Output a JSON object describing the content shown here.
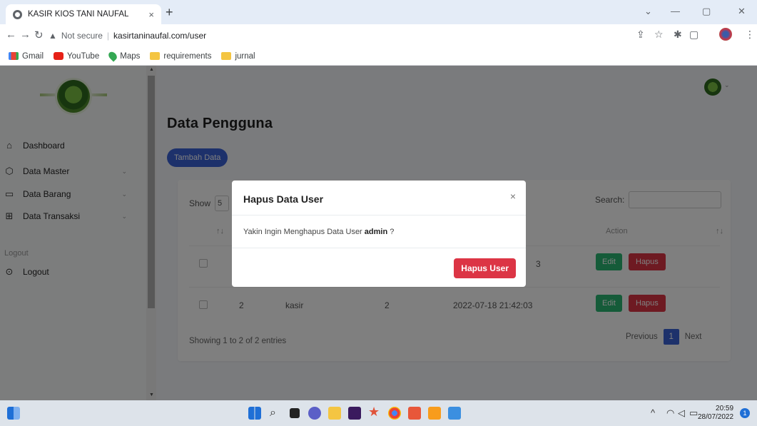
{
  "browser": {
    "tab_title": "KASIR KIOS TANI NAUFAL",
    "tab_close": "×",
    "new_tab": "+",
    "security": "Not secure",
    "url": "kasirtaninaufal.com/user",
    "bookmarks": [
      "Gmail",
      "YouTube",
      "Maps",
      "requirements",
      "jurnal"
    ]
  },
  "sidebar": {
    "items": [
      {
        "label": "Dashboard"
      },
      {
        "label": "Data Master"
      },
      {
        "label": "Data Barang"
      },
      {
        "label": "Data Transaksi"
      }
    ],
    "section": "Logout",
    "logout": "Logout"
  },
  "main": {
    "title": "Data Pengguna",
    "add_button": "Tambah Data"
  },
  "table": {
    "show_label": "Show",
    "show_value": "5",
    "search_label": "Search:",
    "columns": [
      "↑↓",
      "Action"
    ],
    "rows": [
      {
        "created": "3",
        "edit": "Edit",
        "delete": "Hapus"
      },
      {
        "no": "2",
        "username": "kasir",
        "level": "2",
        "created": "2022-07-18 21:42:03",
        "edit": "Edit",
        "delete": "Hapus"
      }
    ],
    "info": "Showing 1 to 2 of 2 entries",
    "pager": {
      "prev": "Previous",
      "current": "1",
      "next": "Next"
    }
  },
  "modal": {
    "title": "Hapus Data User",
    "close": "×",
    "message_prefix": "Yakin Ingin Menghapus Data User ",
    "message_user": "admin",
    "message_suffix": " ?",
    "confirm": "Hapus User"
  },
  "taskbar": {
    "time": "20:59",
    "date": "28/07/2022",
    "notifications": "1"
  },
  "colors": {
    "primary": "#3b62d6",
    "danger": "#dc3545",
    "success": "#2bb673"
  }
}
